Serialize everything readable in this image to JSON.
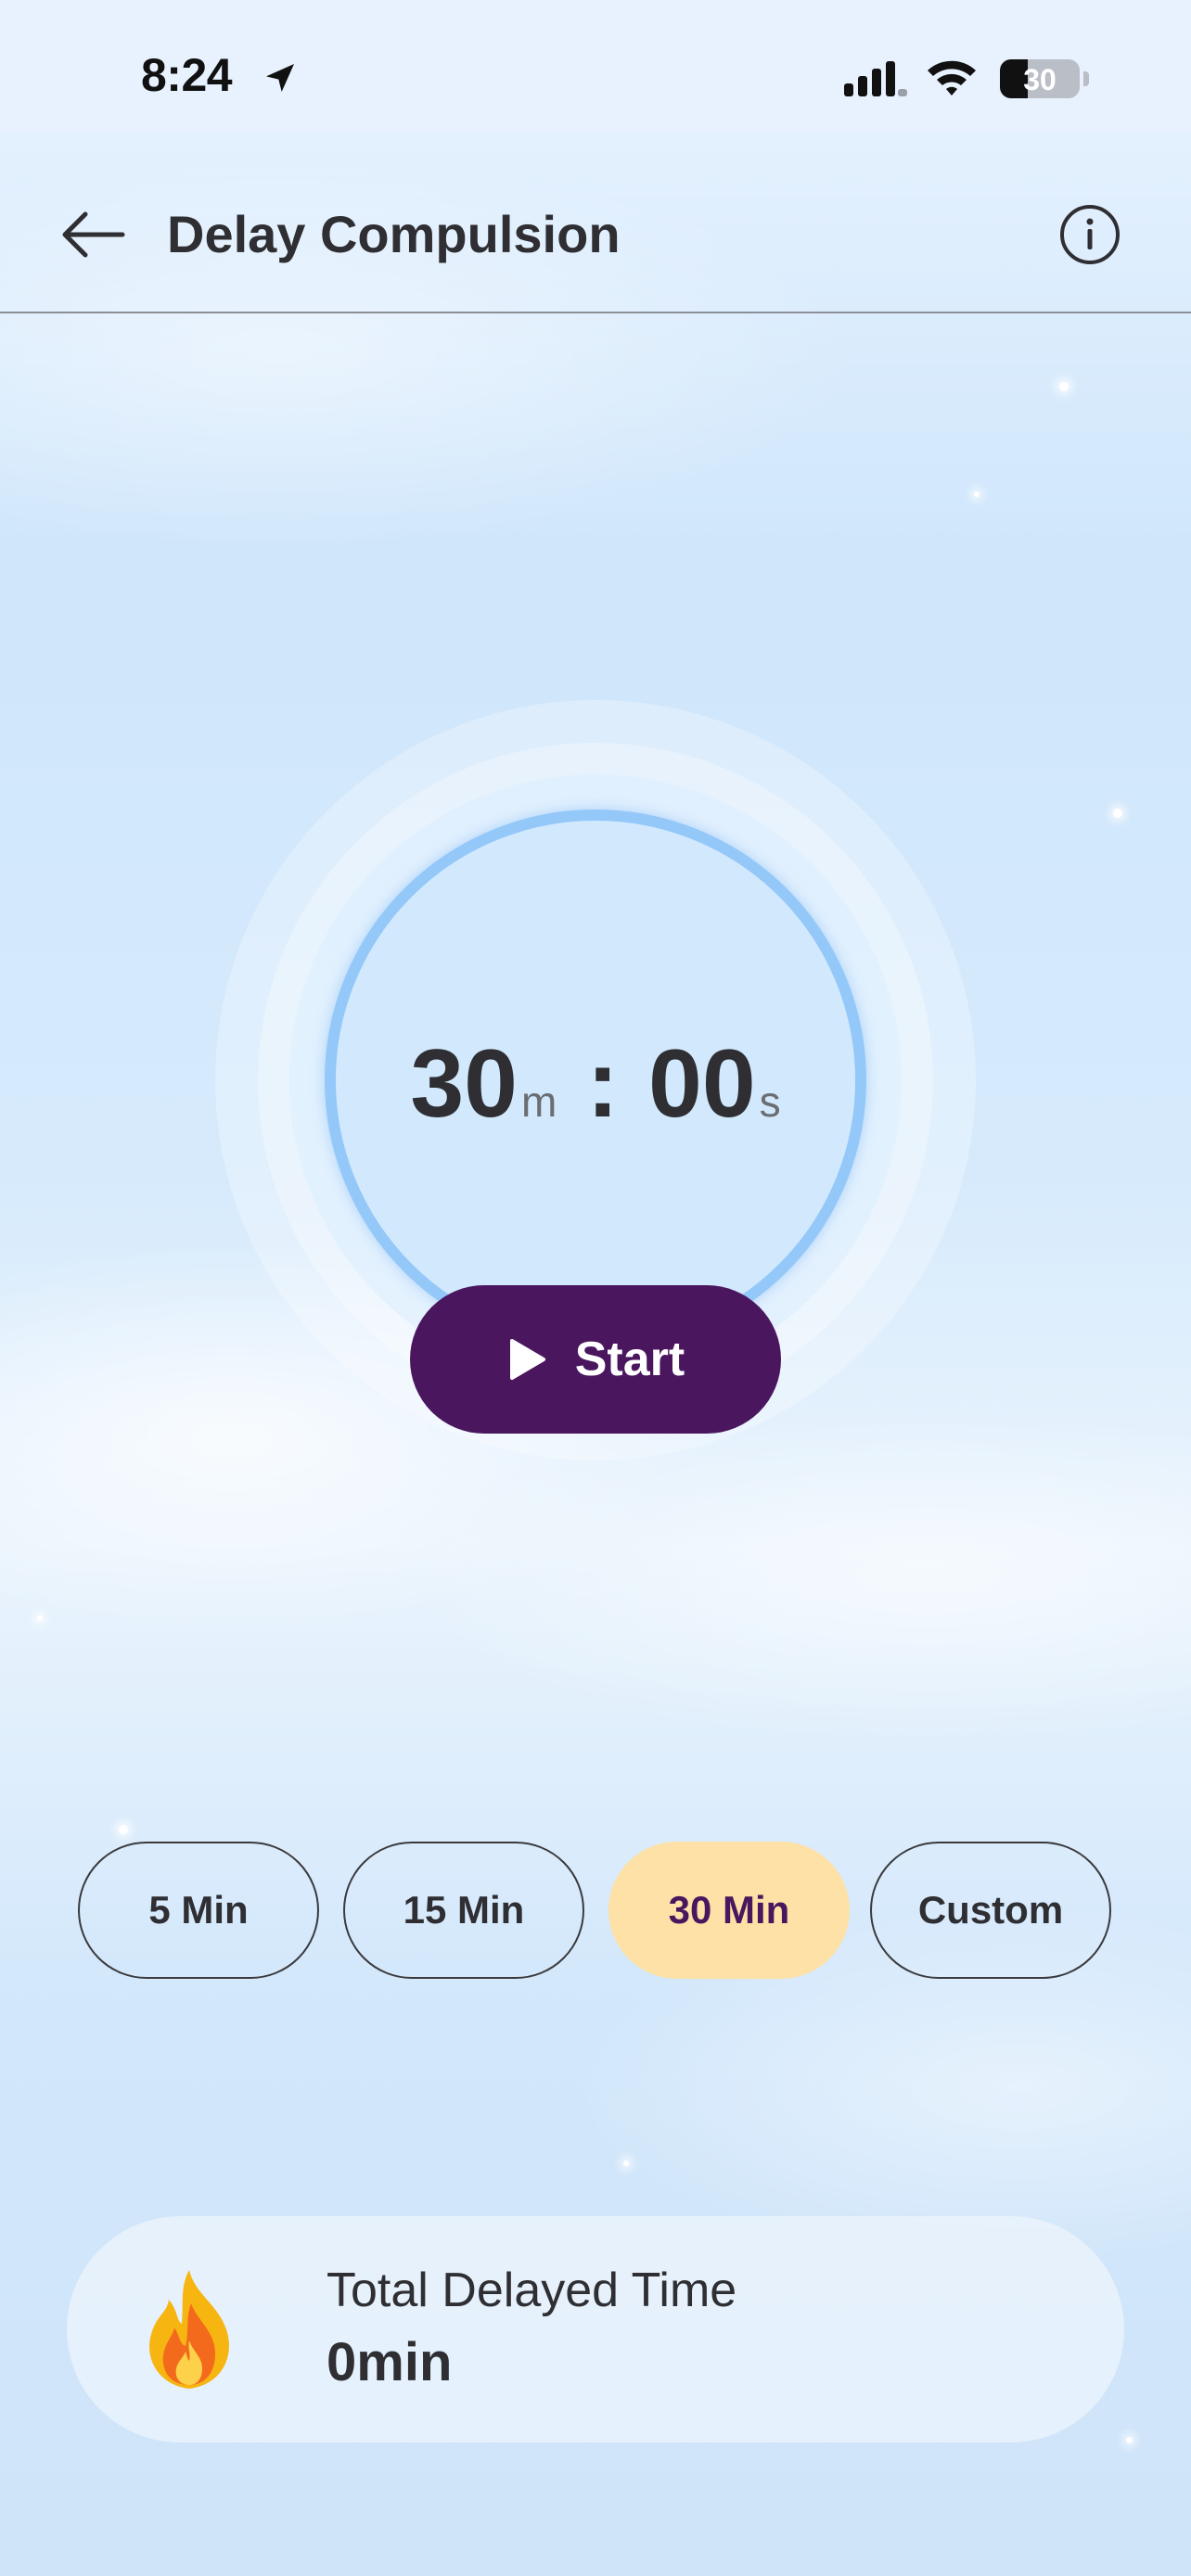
{
  "status_bar": {
    "time": "8:24",
    "battery": "30"
  },
  "header": {
    "title": "Delay Compulsion"
  },
  "timer": {
    "minutes": "30",
    "minutes_unit": "m",
    "separator": ":",
    "seconds": "00",
    "seconds_unit": "s"
  },
  "start_button": {
    "label": "Start"
  },
  "presets": [
    {
      "label": "5 Min",
      "selected": false
    },
    {
      "label": "15 Min",
      "selected": false
    },
    {
      "label": "30 Min",
      "selected": true
    },
    {
      "label": "Custom",
      "selected": false
    }
  ],
  "total": {
    "label": "Total Delayed Time",
    "value": "0min"
  },
  "colors": {
    "accent": "#4a175f",
    "selected_preset": "#fde1a6",
    "ring": "#94c8f9"
  }
}
